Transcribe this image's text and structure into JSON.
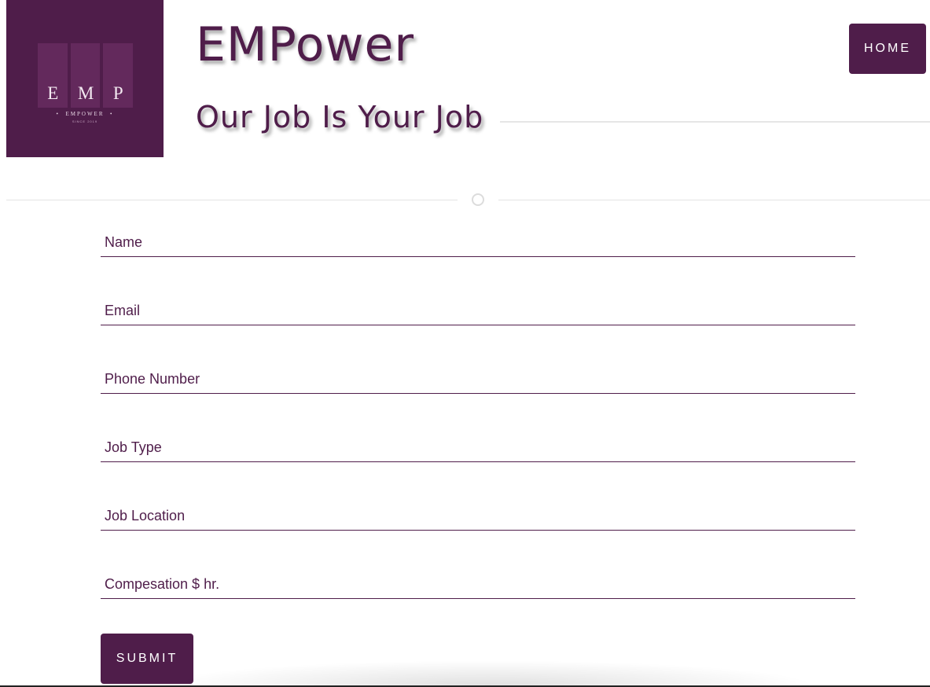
{
  "logo": {
    "letters": [
      "E",
      "M",
      "P"
    ],
    "name": "EMPOWER",
    "subtitle": "SINCE 2019",
    "color": "#4f1d4a"
  },
  "header": {
    "title": "EMPower",
    "tagline": "Our Job Is Your Job",
    "home_label": "HOME"
  },
  "form": {
    "fields": [
      {
        "placeholder": "Name",
        "value": ""
      },
      {
        "placeholder": "Email",
        "value": ""
      },
      {
        "placeholder": "Phone Number",
        "value": ""
      },
      {
        "placeholder": "Job Type",
        "value": ""
      },
      {
        "placeholder": "Job Location",
        "value": ""
      },
      {
        "placeholder": "Compesation $ hr.",
        "value": ""
      }
    ],
    "submit_label": "SUBMIT"
  },
  "colors": {
    "accent": "#4f1d4a",
    "divider": "#e4e4e4"
  }
}
